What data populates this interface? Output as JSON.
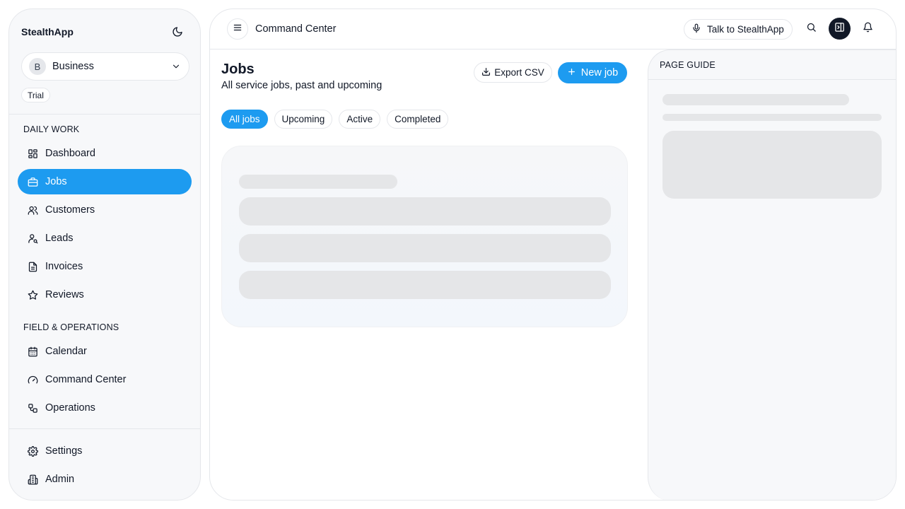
{
  "app": {
    "brand": "StealthApp"
  },
  "workspace": {
    "avatar_initial": "B",
    "name": "Business",
    "plan_badge": "Trial"
  },
  "sidebar": {
    "sections": [
      {
        "label": "DAILY WORK"
      },
      {
        "label": "FIELD & OPERATIONS"
      }
    ],
    "items": [
      {
        "label": "Dashboard",
        "icon": "dashboard-icon"
      },
      {
        "label": "Jobs",
        "icon": "briefcase-icon",
        "active": true
      },
      {
        "label": "Customers",
        "icon": "users-icon"
      },
      {
        "label": "Leads",
        "icon": "user-search-icon"
      },
      {
        "label": "Invoices",
        "icon": "file-text-icon"
      },
      {
        "label": "Reviews",
        "icon": "star-icon"
      },
      {
        "label": "Calendar",
        "icon": "calendar-icon"
      },
      {
        "label": "Command Center",
        "icon": "gauge-icon"
      },
      {
        "label": "Operations",
        "icon": "workflow-icon"
      },
      {
        "label": "Settings",
        "icon": "gear-icon"
      },
      {
        "label": "Admin",
        "icon": "building-icon"
      }
    ]
  },
  "header": {
    "title": "Command Center",
    "talk_label": "Talk to StealthApp"
  },
  "page": {
    "title": "Jobs",
    "subtitle": "All service jobs, past and upcoming",
    "export_label": "Export CSV",
    "new_label": "New job",
    "tabs": [
      "All jobs",
      "Upcoming",
      "Active",
      "Completed"
    ],
    "active_tab": "All jobs"
  },
  "guide": {
    "title": "PAGE GUIDE"
  },
  "colors": {
    "accent": "#1d9bf0",
    "surface": "#f7f8fa",
    "border": "#e5e7eb",
    "skeleton": "#e5e6e8"
  }
}
